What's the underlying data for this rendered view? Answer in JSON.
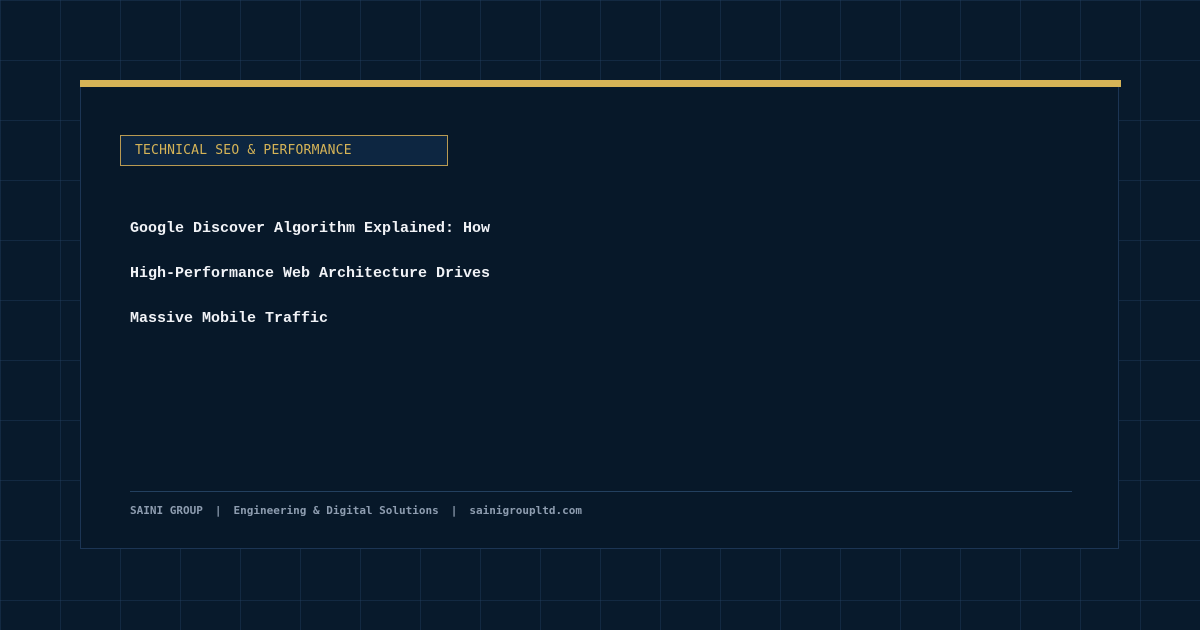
{
  "category": "TECHNICAL SEO & PERFORMANCE",
  "headline": {
    "lines": [
      "Google Discover Algorithm Explained: How",
      "High-Performance Web Architecture Drives",
      "Massive Mobile Traffic"
    ]
  },
  "footer": {
    "brand": "SAINI GROUP",
    "separator": "|",
    "tagline": "Engineering & Digital Solutions",
    "website": "sainigroupltd.com"
  },
  "colors": {
    "background": "#081a2c",
    "accent": "#d6b457",
    "headline": "#f1f3f7",
    "muted": "#8e9db0"
  }
}
